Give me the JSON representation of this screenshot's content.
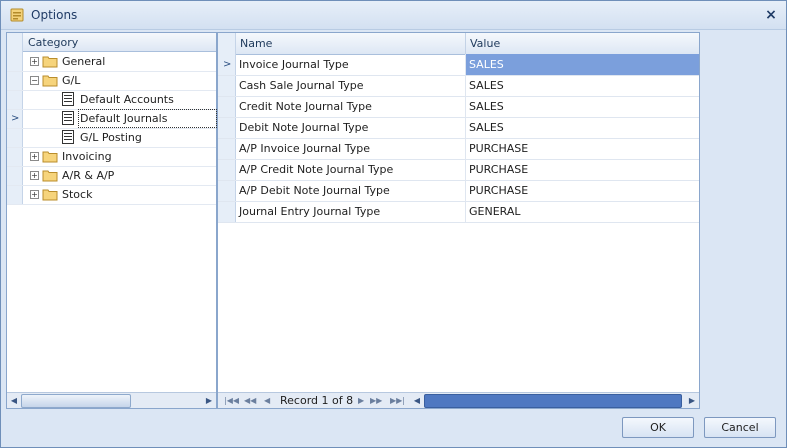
{
  "window": {
    "title": "Options",
    "close_symbol": "×"
  },
  "tree": {
    "header": "Category",
    "items": [
      {
        "label": "General",
        "expander": "+"
      },
      {
        "label": "G/L",
        "expander": "−"
      },
      {
        "label": "Default Accounts"
      },
      {
        "label": "Default Journals"
      },
      {
        "label": "G/L Posting"
      },
      {
        "label": "Invoicing",
        "expander": "+"
      },
      {
        "label": "A/R & A/P",
        "expander": "+"
      },
      {
        "label": "Stock",
        "expander": "+"
      }
    ],
    "row_indicator": ">"
  },
  "grid": {
    "columns": {
      "name": "Name",
      "value": "Value"
    },
    "rows": [
      {
        "name": "Invoice Journal Type",
        "value": "SALES"
      },
      {
        "name": "Cash Sale Journal Type",
        "value": "SALES"
      },
      {
        "name": "Credit Note Journal Type",
        "value": "SALES"
      },
      {
        "name": "Debit Note Journal Type",
        "value": "SALES"
      },
      {
        "name": "A/P Invoice Journal Type",
        "value": "PURCHASE"
      },
      {
        "name": "A/P Credit Note Journal Type",
        "value": "PURCHASE"
      },
      {
        "name": "A/P Debit Note Journal Type",
        "value": "PURCHASE"
      },
      {
        "name": "Journal Entry Journal Type",
        "value": "GENERAL"
      }
    ],
    "row_indicator": ">",
    "navigator": {
      "record_text": "Record 1 of 8"
    }
  },
  "buttons": {
    "ok": "OK",
    "cancel": "Cancel"
  },
  "colors": {
    "selection": "#7b9fdc",
    "border": "#8aa6cc"
  }
}
